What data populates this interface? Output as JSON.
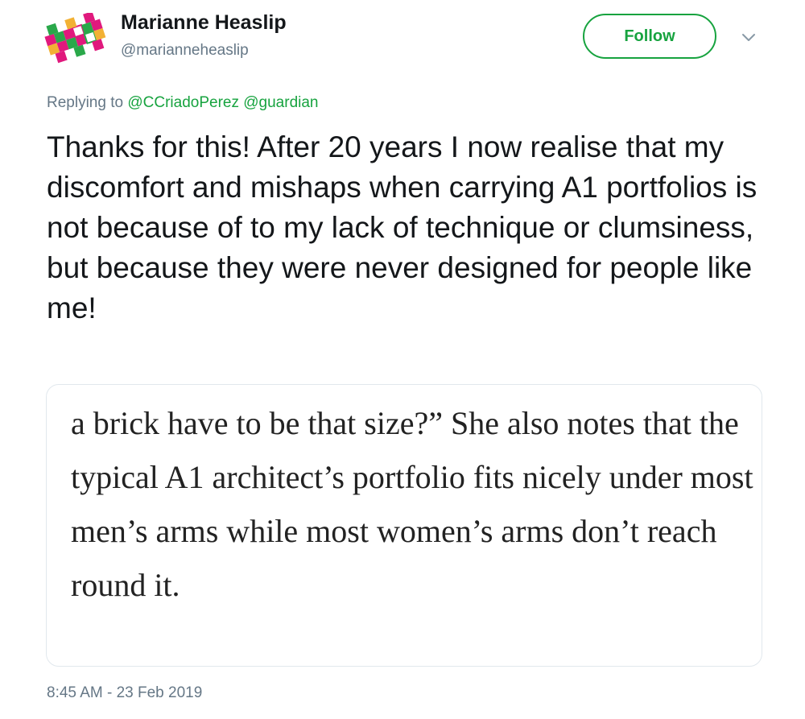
{
  "user": {
    "display_name": "Marianne Heaslip",
    "handle": "@marianneheaslip",
    "avatar_icon": "avatar-pattern-icon"
  },
  "follow_button": {
    "label": "Follow",
    "color": "#17a33f"
  },
  "menu": {
    "icon": "chevron-down-icon"
  },
  "reply": {
    "prefix": "Replying to",
    "mentions": [
      "@CCriadoPerez",
      "@guardian"
    ]
  },
  "tweet": {
    "text": "Thanks for this! After 20 years I now realise that my discomfort and mishaps when carrying A1 portfolios is not because of to my lack of technique or clumsiness, but because they were never designed for people like me!"
  },
  "quote_image": {
    "text": "a brick have to be that size?” She also notes that the typical A1 architect’s portfolio fits nicely under most men’s arms while most women’s arms don’t reach round it."
  },
  "timestamp": "8:45 AM - 23 Feb 2019",
  "colors": {
    "accent": "#17a33f",
    "secondary_text": "#657786",
    "primary_text": "#14171a",
    "card_border": "#e1e8ed"
  }
}
